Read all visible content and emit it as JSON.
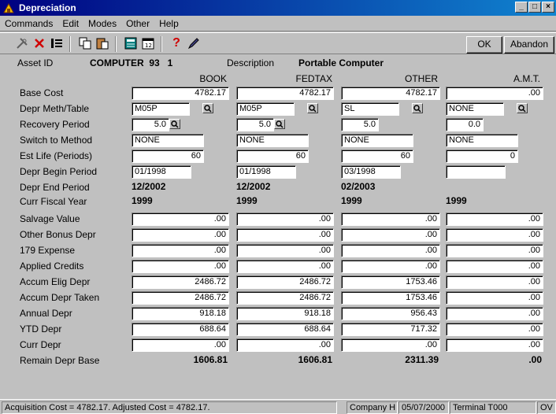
{
  "window": {
    "title": "Depreciation"
  },
  "menu": [
    {
      "label": "Commands",
      "key": "C"
    },
    {
      "label": "Edit",
      "key": "E"
    },
    {
      "label": "Modes",
      "key": "M"
    },
    {
      "label": "Other",
      "key": "O"
    },
    {
      "label": "Help",
      "key": "H"
    }
  ],
  "toolbar": {
    "ok_label": "OK",
    "abandon_label": "Abandon"
  },
  "asset": {
    "id_label": "Asset ID",
    "id_value": "COMPUTER  93   1",
    "desc_label": "Description",
    "desc_value": "Portable Computer"
  },
  "columns": [
    "BOOK",
    "FEDTAX",
    "OTHER",
    "A.M.T."
  ],
  "rows": {
    "base_cost": {
      "label": "Base Cost",
      "values": [
        "4782.17",
        "4782.17",
        "4782.17",
        ".00"
      ]
    },
    "depr_meth": {
      "label": "Depr Meth/Table",
      "values": [
        "M05P",
        "M05P",
        "SL",
        "NONE"
      ]
    },
    "recovery": {
      "label": "Recovery Period",
      "values": [
        "5.0",
        "5.0",
        "5.0",
        "0.0"
      ]
    },
    "switch": {
      "label": "Switch to Method",
      "values": [
        "NONE",
        "NONE",
        "NONE",
        "NONE"
      ]
    },
    "est_life": {
      "label": "Est Life (Periods)",
      "values": [
        "60",
        "60",
        "60",
        "0"
      ]
    },
    "begin": {
      "label": "Depr Begin Period",
      "values": [
        "01/1998",
        "01/1998",
        "03/1998",
        ""
      ]
    },
    "end": {
      "label": "Depr End Period",
      "values": [
        "12/2002",
        "12/2002",
        "02/2003",
        ""
      ]
    },
    "fiscal": {
      "label": "Curr Fiscal Year",
      "values": [
        "1999",
        "1999",
        "1999",
        "1999"
      ]
    },
    "salvage": {
      "label": "Salvage Value",
      "values": [
        ".00",
        ".00",
        ".00",
        ".00"
      ]
    },
    "bonus": {
      "label": "Other Bonus Depr",
      "values": [
        ".00",
        ".00",
        ".00",
        ".00"
      ]
    },
    "exp179": {
      "label": "179 Expense",
      "values": [
        ".00",
        ".00",
        ".00",
        ".00"
      ]
    },
    "credits": {
      "label": "Applied Credits",
      "values": [
        ".00",
        ".00",
        ".00",
        ".00"
      ]
    },
    "elig": {
      "label": "Accum Elig Depr",
      "values": [
        "2486.72",
        "2486.72",
        "1753.46",
        ".00"
      ]
    },
    "taken": {
      "label": "Accum Depr Taken",
      "values": [
        "2486.72",
        "2486.72",
        "1753.46",
        ".00"
      ]
    },
    "annual": {
      "label": "Annual Depr",
      "values": [
        "918.18",
        "918.18",
        "956.43",
        ".00"
      ]
    },
    "ytd": {
      "label": "YTD Depr",
      "values": [
        "688.64",
        "688.64",
        "717.32",
        ".00"
      ]
    },
    "curr": {
      "label": "Curr Depr",
      "values": [
        ".00",
        ".00",
        ".00",
        ".00"
      ]
    },
    "remain": {
      "label": "Remain Depr Base",
      "values": [
        "1606.81",
        "1606.81",
        "2311.39",
        ".00"
      ]
    }
  },
  "status": {
    "cost_info": "Acquisition Cost = 4782.17.  Adjusted Cost = 4782.17.",
    "company": "Company H",
    "date": "05/07/2000",
    "terminal": "Terminal T000",
    "mode": "OV"
  }
}
